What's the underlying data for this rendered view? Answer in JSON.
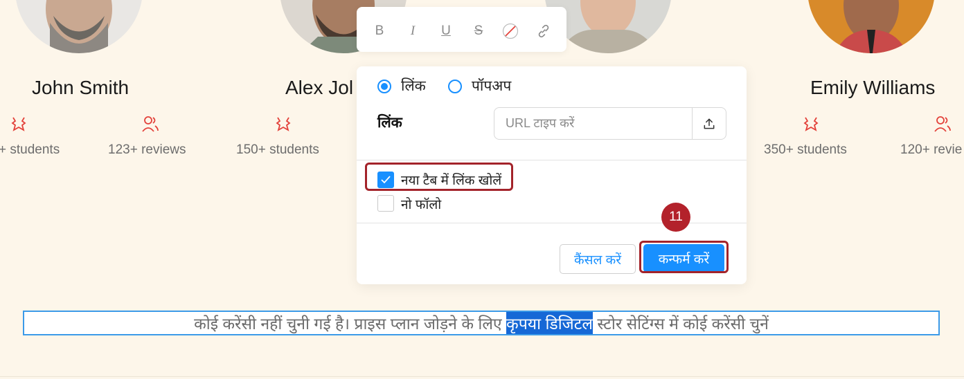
{
  "instructors": [
    {
      "name": "John Smith"
    },
    {
      "name": "Alex Jol"
    },
    {
      "name": "Emily Williams"
    }
  ],
  "stats": [
    {
      "text": "+ students"
    },
    {
      "text": "123+ reviews"
    },
    {
      "text": "150+ students"
    },
    {
      "text": "350+ students"
    },
    {
      "text": "120+ revie"
    }
  ],
  "toolbar": {
    "buttons": [
      {
        "icon": "bold-icon",
        "glyph": "B"
      },
      {
        "icon": "italic-icon",
        "glyph": "I"
      },
      {
        "icon": "underline-icon",
        "glyph": "U"
      },
      {
        "icon": "strikethrough-icon",
        "glyph": "S"
      },
      {
        "icon": "color-none-icon",
        "glyph": ""
      },
      {
        "icon": "link-icon",
        "glyph": ""
      }
    ]
  },
  "link_dialog": {
    "radio_link": "लिंक",
    "radio_popup": "पॉपअप",
    "field_label": "लिंक",
    "url_placeholder": "URL टाइप करें",
    "url_value": "",
    "open_new_tab_label": "नया टैब में लिंक खोलें",
    "open_new_tab_checked": true,
    "nofollow_label": "नो फॉलो",
    "nofollow_checked": false,
    "cancel_label": "कैंसल करें",
    "confirm_label": "कन्फर्म करें"
  },
  "step_badge": "11",
  "note": {
    "before": "कोई करेंसी नहीं चुनी गई है। प्राइस प्लान जोड़ने के लिए ",
    "selected": "कृपया डिजिटल",
    "after": " स्टोर सेटिंग्स में कोई करेंसी चुनें"
  },
  "colors": {
    "background": "#fdf6ea",
    "accent": "#1890ff",
    "highlight": "#a3232a",
    "icon_red": "#e3413a"
  }
}
